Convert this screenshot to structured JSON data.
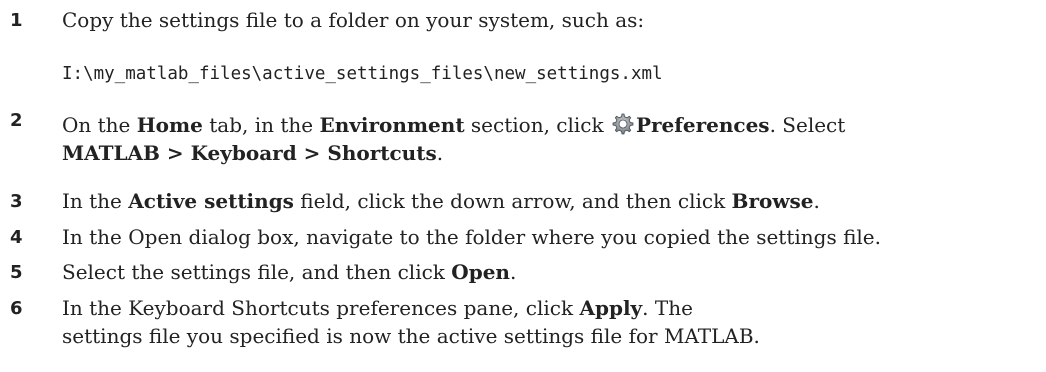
{
  "steps": [
    {
      "number": "1",
      "parts": [
        "Copy the settings file to a folder on your system, such as:"
      ],
      "code": "I:\\my_matlab_files\\active_settings_files\\new_settings.xml"
    },
    {
      "number": "2",
      "parts": [
        "On the ",
        "Home",
        " tab, in the ",
        "Environment",
        " section, click ",
        "Preferences",
        ". Select ",
        "MATLAB > Keyboard > Shortcuts",
        "."
      ],
      "icon": "gear-icon"
    },
    {
      "number": "3",
      "parts": [
        "In the ",
        "Active settings",
        " field, click the down arrow, and then click ",
        "Browse",
        "."
      ]
    },
    {
      "number": "4",
      "parts": [
        "In the Open dialog box, navigate to the folder where you copied the settings file."
      ]
    },
    {
      "number": "5",
      "parts": [
        "Select the settings file, and then click ",
        "Open",
        "."
      ]
    },
    {
      "number": "6",
      "parts": [
        "In the Keyboard Shortcuts preferences pane, click ",
        "Apply",
        ". The settings file you specified is now the active settings file for MATLAB."
      ]
    }
  ]
}
